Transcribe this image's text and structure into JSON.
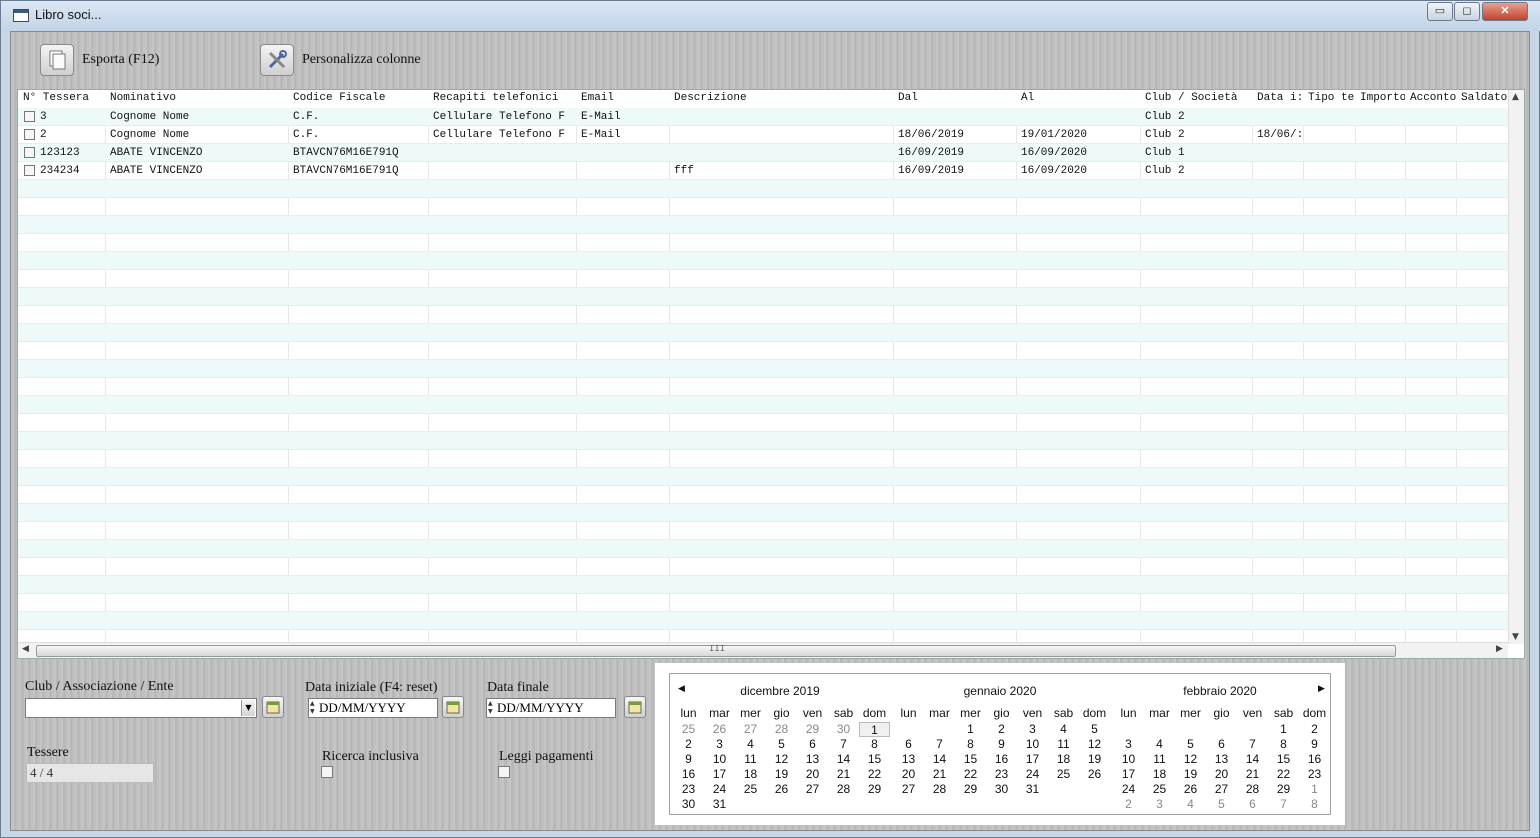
{
  "window": {
    "title": "Libro soci...",
    "min_label": "▭",
    "max_label": "◻",
    "close_label": "✕"
  },
  "toolbar": {
    "export_label": "Esporta (F12)",
    "columns_label": "Personalizza colonne"
  },
  "grid": {
    "columns": [
      "N° Tessera",
      "Nominativo",
      "Codice Fiscale",
      "Recapiti telefonici",
      "Email",
      "Descrizione",
      "Dal",
      "Al",
      "Club / Società",
      "Data i:",
      "Tipo te",
      "Importo",
      "Acconto",
      "Saldato"
    ],
    "rows": [
      [
        "3",
        "Cognome Nome",
        "C.F.",
        "Cellulare Telefono F",
        "E-Mail",
        "",
        "",
        "",
        "Club 2",
        "",
        "",
        "",
        "",
        ""
      ],
      [
        "2",
        "Cognome Nome",
        "C.F.",
        "Cellulare Telefono F",
        "E-Mail",
        "",
        "18/06/2019",
        "19/01/2020",
        "Club 2",
        "18/06/:",
        "",
        "",
        "",
        ""
      ],
      [
        "123123",
        "ABATE VINCENZO",
        "BTAVCN76M16E791Q",
        "",
        "",
        "",
        "16/09/2019",
        "16/09/2020",
        "Club 1",
        "",
        "",
        "",
        "",
        ""
      ],
      [
        "234234",
        "ABATE VINCENZO",
        "BTAVCN76M16E791Q",
        "",
        "",
        "fff",
        "16/09/2019",
        "16/09/2020",
        "Club 2",
        "",
        "",
        "",
        "",
        ""
      ]
    ],
    "scroll_up": "▲",
    "scroll_down": "▼",
    "scroll_left": "◀",
    "scroll_right": "▶",
    "thumb_grip": "III"
  },
  "filters": {
    "club_label": "Club / Associazione / Ente",
    "club_value": "",
    "start_label": "Data iniziale (F4: reset)",
    "start_value": "DD/MM/YYYY",
    "end_label": "Data finale",
    "end_value": "DD/MM/YYYY",
    "tessere_label": "Tessere",
    "tessere_value": "4 / 4",
    "inclusive_label": "Ricerca inclusiva",
    "payments_label": "Leggi pagamenti"
  },
  "calendar": {
    "dow": [
      "lun",
      "mar",
      "mer",
      "gio",
      "ven",
      "sab",
      "dom"
    ],
    "months": [
      {
        "title": "dicembre 2019",
        "weeks": [
          [
            "25",
            "26",
            "27",
            "28",
            "29",
            "30",
            "1"
          ],
          [
            "2",
            "3",
            "4",
            "5",
            "6",
            "7",
            "8"
          ],
          [
            "9",
            "10",
            "11",
            "12",
            "13",
            "14",
            "15"
          ],
          [
            "16",
            "17",
            "18",
            "19",
            "20",
            "21",
            "22"
          ],
          [
            "23",
            "24",
            "25",
            "26",
            "27",
            "28",
            "29"
          ],
          [
            "30",
            "31",
            "",
            "",
            "",
            "",
            ""
          ]
        ]
      },
      {
        "title": "gennaio 2020",
        "weeks": [
          [
            "",
            "",
            "1",
            "2",
            "3",
            "4",
            "5"
          ],
          [
            "6",
            "7",
            "8",
            "9",
            "10",
            "11",
            "12"
          ],
          [
            "13",
            "14",
            "15",
            "16",
            "17",
            "18",
            "19"
          ],
          [
            "20",
            "21",
            "22",
            "23",
            "24",
            "25",
            "26"
          ],
          [
            "27",
            "28",
            "29",
            "30",
            "31",
            "",
            ""
          ],
          [
            "",
            "",
            "",
            "",
            "",
            "",
            ""
          ]
        ]
      },
      {
        "title": "febbraio 2020",
        "weeks": [
          [
            "",
            "",
            "",
            "",
            "",
            "1",
            "2"
          ],
          [
            "3",
            "4",
            "5",
            "6",
            "7",
            "8",
            "9"
          ],
          [
            "10",
            "11",
            "12",
            "13",
            "14",
            "15",
            "16"
          ],
          [
            "17",
            "18",
            "19",
            "20",
            "21",
            "22",
            "23"
          ],
          [
            "24",
            "25",
            "26",
            "27",
            "28",
            "29",
            "1"
          ],
          [
            "2",
            "3",
            "4",
            "5",
            "6",
            "7",
            "8"
          ]
        ]
      }
    ],
    "prev_label": "◀",
    "next_label": "▶"
  }
}
